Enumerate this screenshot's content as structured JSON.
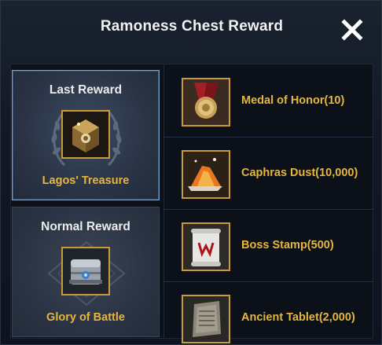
{
  "window": {
    "title": "Ramoness Chest Reward"
  },
  "close_icon": "close-icon",
  "rewards": {
    "last": {
      "title": "Last Reward",
      "name": "Lagos' Treasure",
      "icon": "treasure-box-icon"
    },
    "normal": {
      "title": "Normal Reward",
      "name": "Glory of Battle",
      "icon": "armored-chest-icon"
    }
  },
  "items": [
    {
      "label": "Medal of Honor(10)",
      "icon": "medal-icon"
    },
    {
      "label": "Caphras Dust(10,000)",
      "icon": "dust-pile-icon"
    },
    {
      "label": "Boss Stamp(500)",
      "icon": "scroll-stamp-icon"
    },
    {
      "label": "Ancient Tablet(2,000)",
      "icon": "stone-tablet-icon"
    }
  ],
  "colors": {
    "accent_gold": "#e7b63e",
    "frame_gold": "#c99a3a",
    "selected_border": "#7fa2c9"
  }
}
